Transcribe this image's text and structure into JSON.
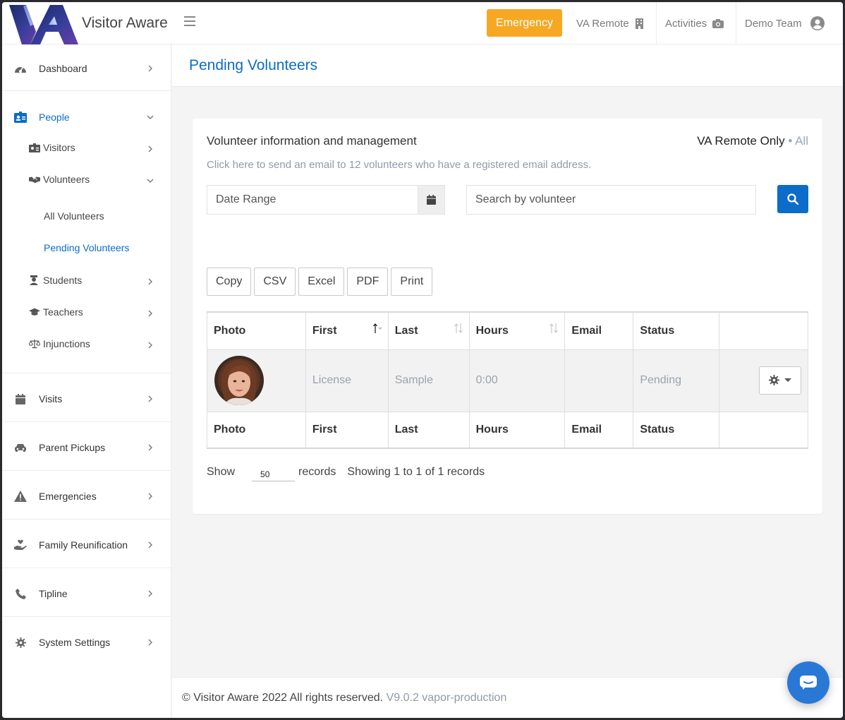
{
  "app": {
    "name": "Visitor Aware"
  },
  "topnav": {
    "emergency_label": "Emergency",
    "va_remote_label": "VA Remote",
    "activities_label": "Activities",
    "user_label": "Demo Team",
    "emergency_color": "#f7a823"
  },
  "sidebar": {
    "dashboard": "Dashboard",
    "people": "People",
    "visitors": "Visitors",
    "volunteers": "Volunteers",
    "all_volunteers": "All Volunteers",
    "pending_volunteers": "Pending Volunteers",
    "students": "Students",
    "teachers": "Teachers",
    "injunctions": "Injunctions",
    "visits": "Visits",
    "parent_pickups": "Parent Pickups",
    "emergencies": "Emergencies",
    "family_reunification": "Family Reunification",
    "tipline": "Tipline",
    "system_settings": "System Settings"
  },
  "page": {
    "title": "Pending Volunteers",
    "card_title": "Volunteer information and management",
    "filter_remote": "VA Remote Only",
    "filter_sep": " • ",
    "filter_all": "All",
    "email_link": "Click here to send an email to 12 volunteers who have a registered email address.",
    "date_range_placeholder": "Date Range",
    "search_placeholder": "Search by volunteer",
    "accent": "#0c6cc9"
  },
  "export_buttons": [
    "Copy",
    "CSV",
    "Excel",
    "PDF",
    "Print"
  ],
  "table": {
    "columns": [
      "Photo",
      "First",
      "Last",
      "Hours",
      "Email",
      "Status",
      ""
    ],
    "rows": [
      {
        "first": "License",
        "last": "Sample",
        "hours": "0:00",
        "email": "",
        "status": "Pending"
      }
    ]
  },
  "pagination": {
    "show_label": "Show",
    "page_size": "50",
    "records_label": "records",
    "info": "Showing 1 to 1 of 1 records"
  },
  "footer": {
    "copyright": "© Visitor Aware 2022 All rights reserved.",
    "version": "V9.0.2 vapor-production"
  }
}
